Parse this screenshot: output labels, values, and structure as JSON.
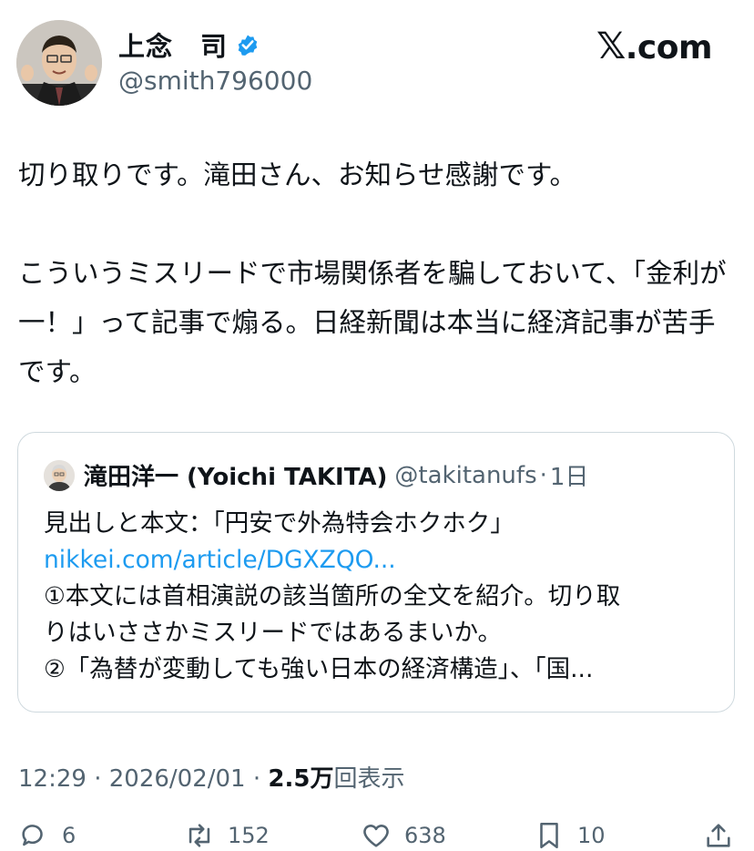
{
  "author": {
    "name": "上念　司",
    "handle": "@smith796000",
    "verified_color": "#1d9bf0"
  },
  "site_logo": {
    "glyph": "𝕏",
    "text": ".com"
  },
  "post": {
    "text": "切り取りです。滝田さん、お知らせ感謝です。\n\nこういうミスリードで市場関係者を騙しておいて、「金利が一！」って記事で煽る。日経新聞は本当に経済記事が苦手です。"
  },
  "quote": {
    "author_name": "滝田洋一 (Yoichi TAKITA)",
    "author_handle": "@takitanufs",
    "separator": "·",
    "time": "1日",
    "lines": [
      "見出しと本文：「円安で外為特会ホクホク」",
      "nikkei.com/article/DGXZQO...",
      "①本文には首相演説の該当箇所の全文を紹介。切り取",
      "りはいささかミスリードではあるまいか。",
      "②「為替が変動しても強い日本の経済構造」、「国..."
    ]
  },
  "meta": {
    "time": "12:29",
    "sep1": "·",
    "date": "2026/02/01",
    "sep2": "·",
    "views": "2.5万",
    "views_label": "回表示"
  },
  "actions": {
    "replies": "6",
    "reposts": "152",
    "likes": "638",
    "bookmarks": "10"
  }
}
